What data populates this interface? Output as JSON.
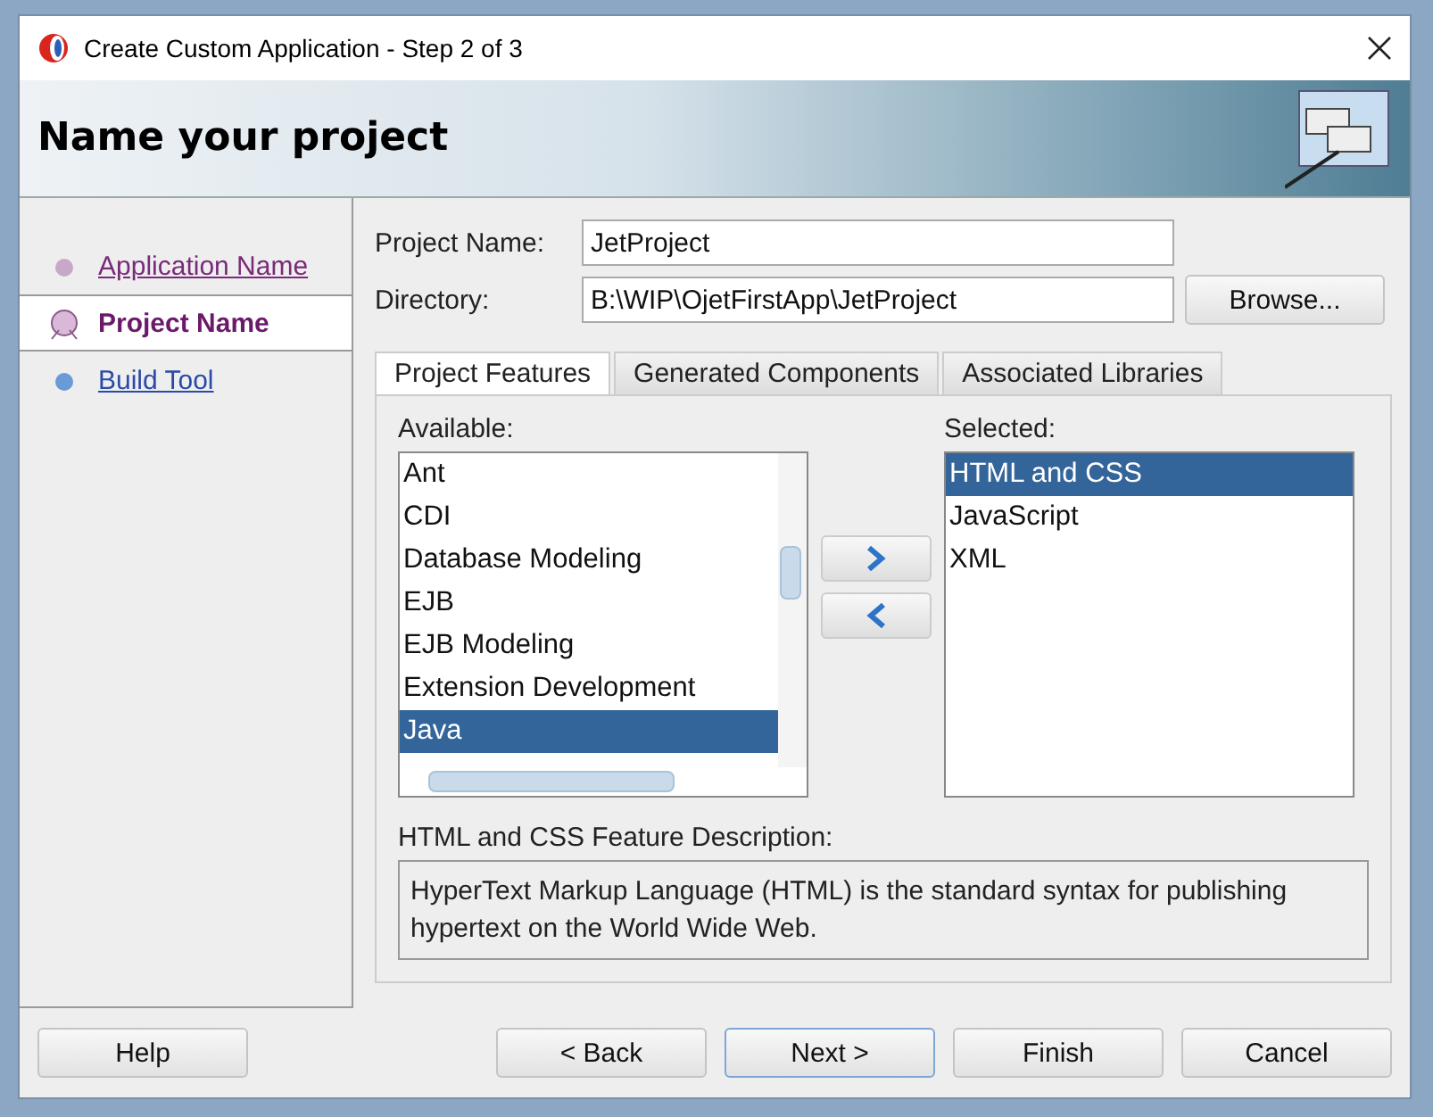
{
  "window": {
    "title": "Create Custom Application - Step 2 of 3"
  },
  "header": {
    "title": "Name your project"
  },
  "steps": [
    {
      "label": "Application Name",
      "selected": false,
      "visited": true
    },
    {
      "label": "Project Name",
      "selected": true,
      "visited": true
    },
    {
      "label": "Build Tool",
      "selected": false,
      "visited": false
    }
  ],
  "form": {
    "project_name": {
      "label": "Project Name:",
      "value": "JetProject"
    },
    "directory": {
      "label": "Directory:",
      "value": "B:\\WIP\\OjetFirstApp\\JetProject"
    },
    "browse_button": "Browse..."
  },
  "tabs": [
    {
      "label": "Project Features",
      "selected": true
    },
    {
      "label": "Generated Components",
      "selected": false
    },
    {
      "label": "Associated Libraries",
      "selected": false
    }
  ],
  "available": {
    "label": "Available:",
    "items": [
      {
        "label": "Ant",
        "selected": false
      },
      {
        "label": "CDI",
        "selected": false
      },
      {
        "label": "Database Modeling",
        "selected": false
      },
      {
        "label": "EJB",
        "selected": false
      },
      {
        "label": "EJB Modeling",
        "selected": false
      },
      {
        "label": "Extension Development",
        "selected": false
      },
      {
        "label": "Java",
        "selected": true
      }
    ]
  },
  "selected_list": {
    "label": "Selected:",
    "items": [
      {
        "label": "HTML and CSS",
        "selected": true
      },
      {
        "label": "JavaScript",
        "selected": false
      },
      {
        "label": "XML",
        "selected": false
      }
    ]
  },
  "description": {
    "label": "HTML and CSS Feature Description:",
    "text": "HyperText Markup Language (HTML) is the standard syntax for publishing hypertext on the World Wide Web."
  },
  "buttons": [
    {
      "label": "Help",
      "kind": "left",
      "default": false
    },
    {
      "label": "< Back",
      "kind": "right",
      "default": false
    },
    {
      "label": "Next >",
      "kind": "right",
      "default": true
    },
    {
      "label": "Finish",
      "kind": "right",
      "default": false
    },
    {
      "label": "Cancel",
      "kind": "right",
      "default": false
    }
  ]
}
